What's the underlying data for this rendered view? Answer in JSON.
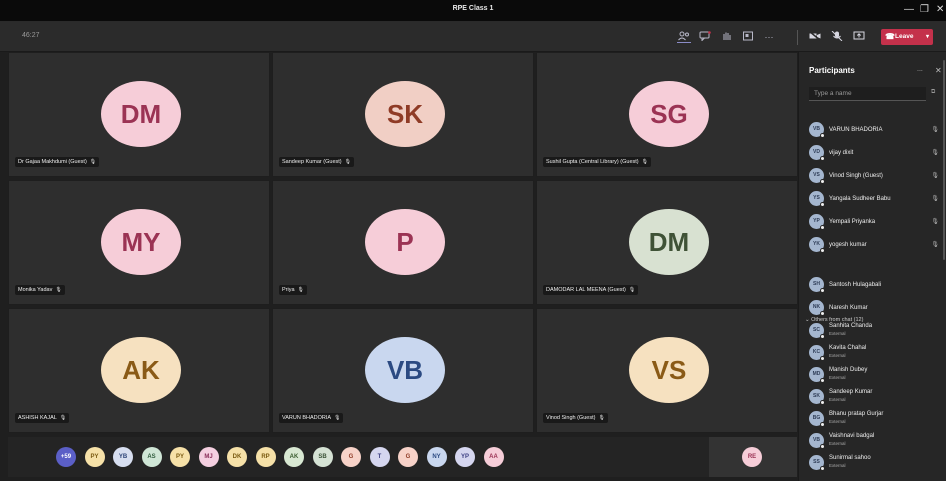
{
  "window": {
    "title": "RPE Class 1",
    "minimize": "—",
    "maximize": "❐",
    "close": "✕"
  },
  "toolbar": {
    "timer": "46:27",
    "leave_label": "Leave",
    "icons": [
      "people-icon",
      "chat-icon",
      "raise-hand-icon",
      "share-tray-icon",
      "more-icon",
      "camera-icon",
      "mic-icon",
      "share-icon"
    ]
  },
  "tiles": [
    {
      "initials": "DM",
      "name": "Dr Gajaa Makhdumi (Guest)",
      "bg": "#f6cdd8",
      "fg": "#9b3354"
    },
    {
      "initials": "SK",
      "name": "Sandeep Kumar (Guest)",
      "bg": "#f1cfc5",
      "fg": "#8f3b26"
    },
    {
      "initials": "SG",
      "name": "Sushil Gupta (Central Library) (Guest)",
      "bg": "#f6cdd8",
      "fg": "#9b3354"
    },
    {
      "initials": "MY",
      "name": "Monika Yadav",
      "bg": "#f6cdd8",
      "fg": "#9b3354"
    },
    {
      "initials": "P",
      "name": "Priya",
      "bg": "#f6cdd8",
      "fg": "#9b3354"
    },
    {
      "initials": "DM",
      "name": "DAMODAR LAL MEENA (Guest)",
      "bg": "#d8e1d1",
      "fg": "#3f5236"
    },
    {
      "initials": "AK",
      "name": "ASHISH KAJAL",
      "bg": "#f6e1c0",
      "fg": "#8a5a16"
    },
    {
      "initials": "VB",
      "name": "VARUN BHADORIA",
      "bg": "#c9d7ef",
      "fg": "#2b4a82"
    },
    {
      "initials": "VS",
      "name": "Vinod Singh (Guest)",
      "bg": "#f6e1c0",
      "fg": "#8a5a16"
    }
  ],
  "bottom_avatars": [
    {
      "initials": "+59",
      "bg": "#5b5fc7",
      "fg": "#ffffff"
    },
    {
      "initials": "PY",
      "bg": "#f6e1a8",
      "fg": "#7a5a10"
    },
    {
      "initials": "YB",
      "bg": "#d7def0",
      "fg": "#2d4478"
    },
    {
      "initials": "AS",
      "bg": "#cfe6d6",
      "fg": "#2f5c3d"
    },
    {
      "initials": "PY",
      "bg": "#f6e1a8",
      "fg": "#7a5a10"
    },
    {
      "initials": "MJ",
      "bg": "#f4cfe0",
      "fg": "#8a2f5a"
    },
    {
      "initials": "DK",
      "bg": "#f6e1a8",
      "fg": "#7a5a10"
    },
    {
      "initials": "RP",
      "bg": "#f6e1a8",
      "fg": "#7a5a10"
    },
    {
      "initials": "AK",
      "bg": "#d8e8d2",
      "fg": "#3a5c2f"
    },
    {
      "initials": "SB",
      "bg": "#d5e2d4",
      "fg": "#3a5236"
    },
    {
      "initials": "G",
      "bg": "#f7d2c8",
      "fg": "#8f3b26"
    },
    {
      "initials": "T",
      "bg": "#d5d6ef",
      "fg": "#3d3f82"
    },
    {
      "initials": "G",
      "bg": "#f7d2c8",
      "fg": "#8f3b26"
    },
    {
      "initials": "NY",
      "bg": "#c9d7ef",
      "fg": "#2b4a82"
    },
    {
      "initials": "YP",
      "bg": "#d5d6ef",
      "fg": "#3d3f82"
    },
    {
      "initials": "AA",
      "bg": "#f6cdd8",
      "fg": "#9b3354"
    },
    {
      "initials": "RE",
      "bg": "#f6cdd8",
      "fg": "#9b3354"
    }
  ],
  "panel": {
    "title": "Participants",
    "more": "...",
    "close": "✕",
    "search_placeholder": "Type a name",
    "section_label": "Others from chat (12)",
    "in_meeting": [
      {
        "initials": "VB",
        "name": "VARUN BHADORIA"
      },
      {
        "initials": "VD",
        "name": "vijay dixit"
      },
      {
        "initials": "VS",
        "name": "Vinod Singh (Guest)"
      },
      {
        "initials": "YS",
        "name": "Yangala Sudheer Babu"
      },
      {
        "initials": "YP",
        "name": "Yempali Priyanka"
      },
      {
        "initials": "YK",
        "name": "yogesh kumar"
      }
    ],
    "from_chat": [
      {
        "initials": "SH",
        "name": "Santosh Hulagabali",
        "sub": ""
      },
      {
        "initials": "NK",
        "name": "Naresh Kumar",
        "sub": ""
      },
      {
        "initials": "SC",
        "name": "Sanhita Chanda",
        "sub": "External"
      },
      {
        "initials": "KC",
        "name": "Kavita Chahal",
        "sub": "External"
      },
      {
        "initials": "MD",
        "name": "Manish Dubey",
        "sub": "External"
      },
      {
        "initials": "SK",
        "name": "Sandeep Kumar",
        "sub": "External"
      },
      {
        "initials": "BG",
        "name": "Bhanu pratap Gurjar",
        "sub": "External"
      },
      {
        "initials": "VB",
        "name": "Vaishnavi badgal",
        "sub": "External"
      },
      {
        "initials": "SS",
        "name": "Sunirmal sahoo",
        "sub": "External"
      }
    ]
  }
}
